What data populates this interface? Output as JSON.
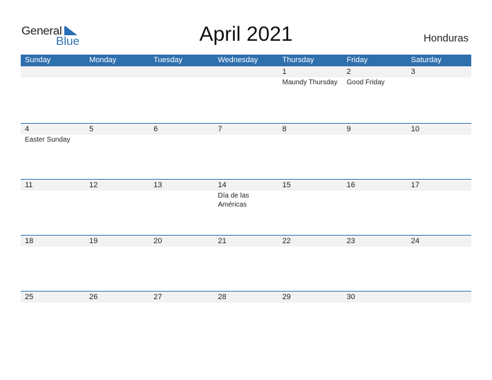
{
  "logo": {
    "general": "General",
    "blue": "Blue",
    "accent": "#2a6fb5"
  },
  "title": "April 2021",
  "country": "Honduras",
  "colors": {
    "header_bg": "#2e6fae",
    "date_strip_bg": "#f2f2f2"
  },
  "weekdays": [
    "Sunday",
    "Monday",
    "Tuesday",
    "Wednesday",
    "Thursday",
    "Friday",
    "Saturday"
  ],
  "weeks": [
    {
      "days": [
        {
          "num": "",
          "event": ""
        },
        {
          "num": "",
          "event": ""
        },
        {
          "num": "",
          "event": ""
        },
        {
          "num": "",
          "event": ""
        },
        {
          "num": "1",
          "event": "Maundy Thursday"
        },
        {
          "num": "2",
          "event": "Good Friday"
        },
        {
          "num": "3",
          "event": ""
        }
      ]
    },
    {
      "days": [
        {
          "num": "4",
          "event": "Easter Sunday"
        },
        {
          "num": "5",
          "event": ""
        },
        {
          "num": "6",
          "event": ""
        },
        {
          "num": "7",
          "event": ""
        },
        {
          "num": "8",
          "event": ""
        },
        {
          "num": "9",
          "event": ""
        },
        {
          "num": "10",
          "event": ""
        }
      ]
    },
    {
      "days": [
        {
          "num": "11",
          "event": ""
        },
        {
          "num": "12",
          "event": ""
        },
        {
          "num": "13",
          "event": ""
        },
        {
          "num": "14",
          "event": "Día de las Américas"
        },
        {
          "num": "15",
          "event": ""
        },
        {
          "num": "16",
          "event": ""
        },
        {
          "num": "17",
          "event": ""
        }
      ]
    },
    {
      "days": [
        {
          "num": "18",
          "event": ""
        },
        {
          "num": "19",
          "event": ""
        },
        {
          "num": "20",
          "event": ""
        },
        {
          "num": "21",
          "event": ""
        },
        {
          "num": "22",
          "event": ""
        },
        {
          "num": "23",
          "event": ""
        },
        {
          "num": "24",
          "event": ""
        }
      ]
    },
    {
      "days": [
        {
          "num": "25",
          "event": ""
        },
        {
          "num": "26",
          "event": ""
        },
        {
          "num": "27",
          "event": ""
        },
        {
          "num": "28",
          "event": ""
        },
        {
          "num": "29",
          "event": ""
        },
        {
          "num": "30",
          "event": ""
        },
        {
          "num": "",
          "event": ""
        }
      ]
    }
  ]
}
